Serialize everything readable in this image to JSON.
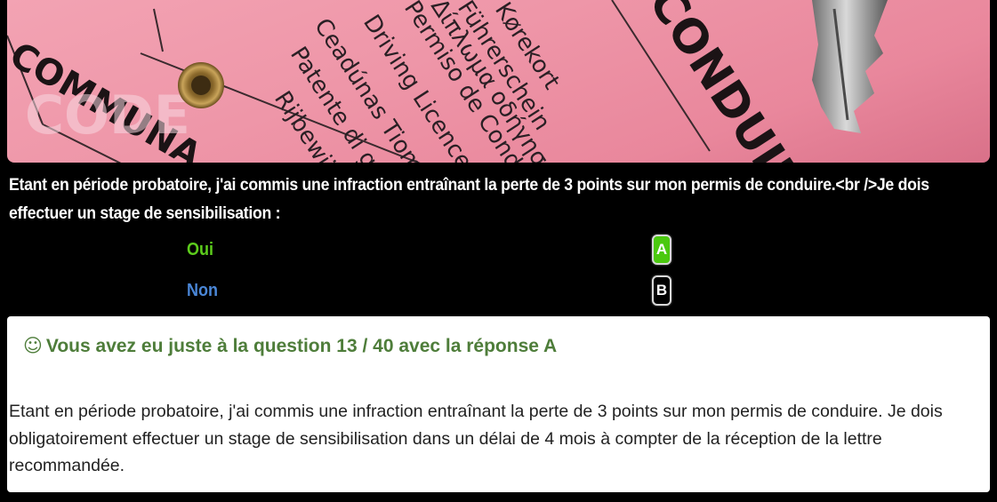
{
  "question": {
    "text": "Etant en période probatoire, j'ai commis une infraction entraînant la perte de 3 points sur mon permis de conduire.<br />Je dois effectuer un stage de sensibilisation :"
  },
  "answers": [
    {
      "label": "Oui",
      "badge": "A",
      "label_color": "#5ccc1c",
      "badge_color": "#4bc90f",
      "selected": true
    },
    {
      "label": "Non",
      "badge": "B",
      "label_color": "#4a86d6",
      "badge_color": "#000000",
      "selected": false
    }
  ],
  "result": {
    "icon": "smiley-icon",
    "title": "Vous avez eu juste à la question 13 / 40 avec la réponse A",
    "explanation": "Etant en période probatoire, j'ai commis une infraction entraînant la perte de 3 points sur mon permis de conduire. Je dois obligatoirement effectuer un stage de sensibilisation dans un délai de 4 mois à compter de la réception de la lettre recommandée."
  },
  "photo": {
    "license_words": [
      "Kørekort",
      "Führerschein",
      "Δίπλωμα οδήγησης",
      "Permiso de Conducción",
      "Driving Licence",
      "Ceadúnas Tiomána",
      "Patente di guida",
      "Rijbewijs",
      "CONDUIRE",
      "COMMUNA"
    ],
    "watermark": "CODE"
  },
  "colors": {
    "background": "#000000",
    "pink": "#ee96a8",
    "title_green": "#4e7d3a"
  }
}
